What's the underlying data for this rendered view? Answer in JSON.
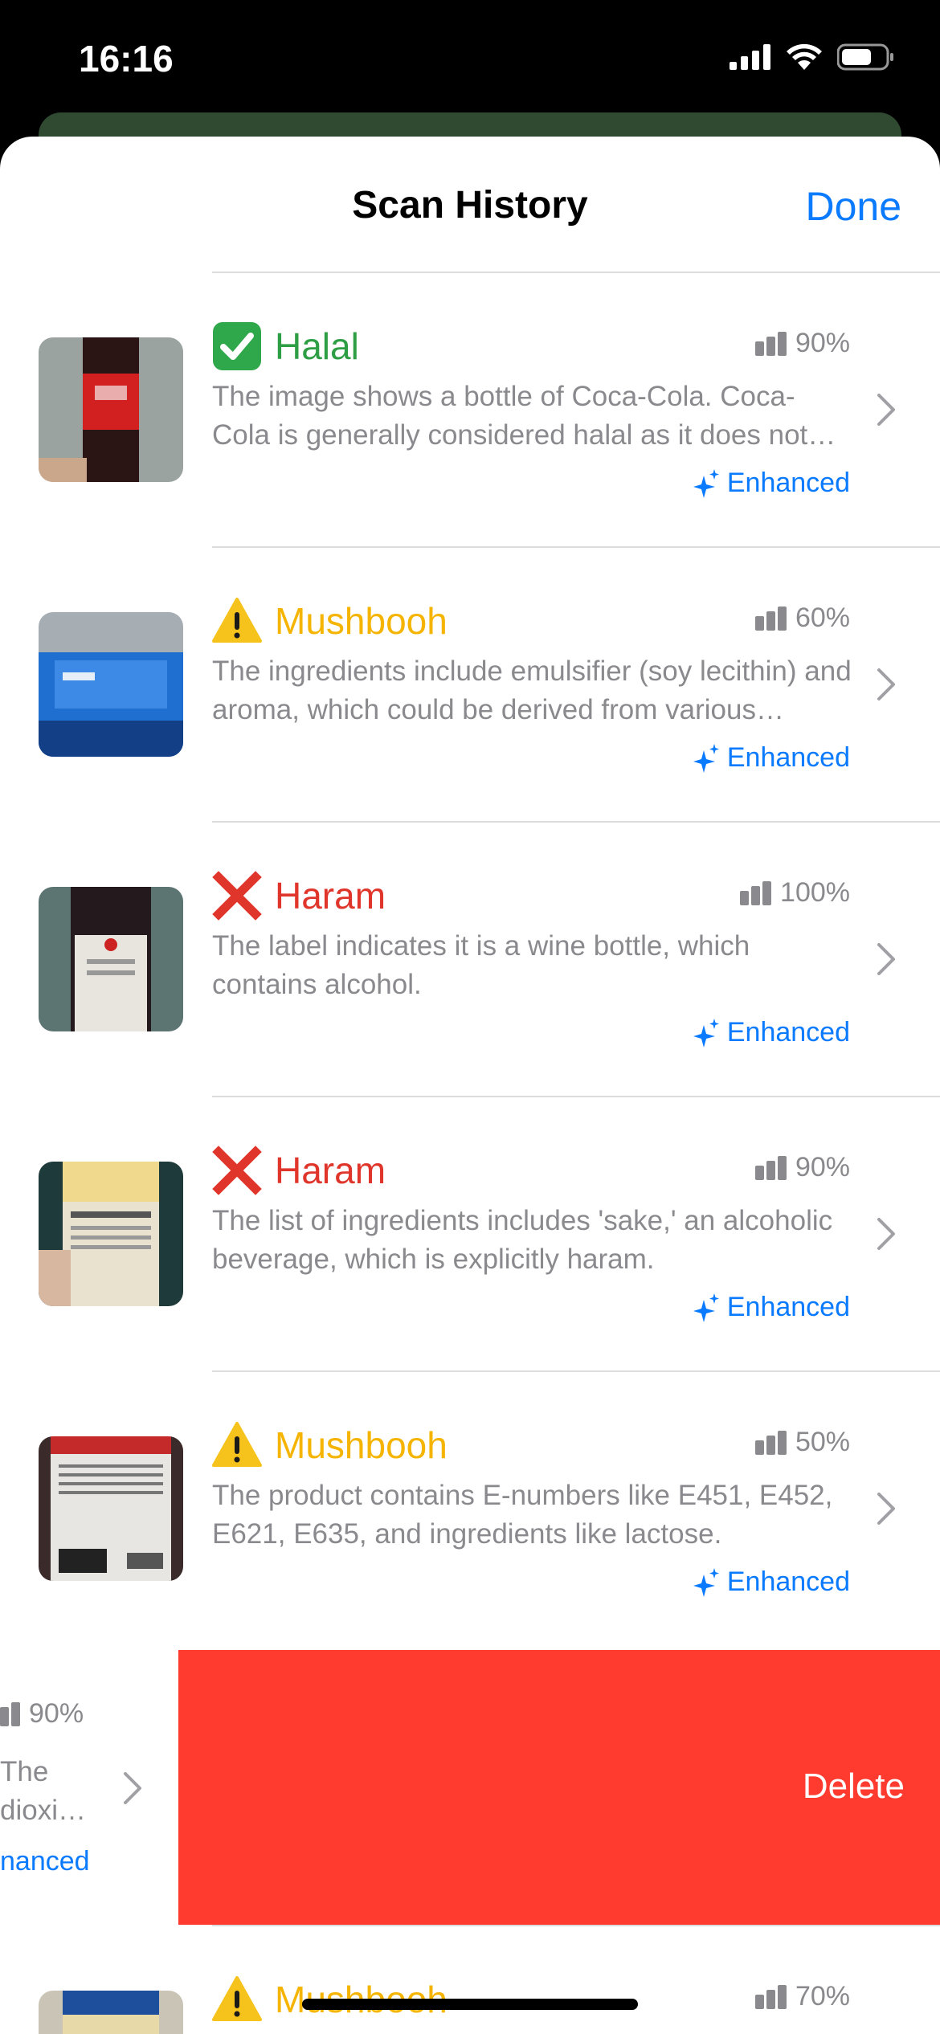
{
  "status_bar": {
    "time": "16:16"
  },
  "sheet": {
    "title": "Scan History",
    "done_label": "Done"
  },
  "items": [
    {
      "verdict": "Halal",
      "verdict_color": "#2e9e44",
      "confidence": "90%",
      "description": "The image shows a bottle of Coca-Cola. Coca-Cola is generally considered halal as it does not contain any haram ingredients.",
      "enhanced_label": "Enhanced",
      "icon": "check-icon"
    },
    {
      "verdict": "Mushbooh",
      "verdict_color": "#f5b400",
      "confidence": "60%",
      "description": "The ingredients include emulsifier (soy lecithin) and aroma, which could be derived from various sources.",
      "enhanced_label": "Enhanced",
      "icon": "warning-icon"
    },
    {
      "verdict": "Haram",
      "verdict_color": "#e0352b",
      "confidence": "100%",
      "description": "The label indicates it is a wine bottle, which contains alcohol.",
      "enhanced_label": "Enhanced",
      "icon": "cross-icon"
    },
    {
      "verdict": "Haram",
      "verdict_color": "#e0352b",
      "confidence": "90%",
      "description": "The list of ingredients includes 'sake,' an alcoholic beverage, which is explicitly haram.",
      "enhanced_label": "Enhanced",
      "icon": "cross-icon"
    },
    {
      "verdict": "Mushbooh",
      "verdict_color": "#f5b400",
      "confidence": "50%",
      "description": "The product contains E-numbers like E451, E452, E621, E635, and ingredients like lactose.",
      "enhanced_label": "Enhanced",
      "icon": "warning-icon"
    }
  ],
  "swiped_item": {
    "confidence": "90%",
    "line1": "The",
    "line2": "dioxi…",
    "enhanced_label": "nanced",
    "delete_label": "Delete"
  },
  "partial_item": {
    "verdict": "Mushbooh",
    "confidence": "70%"
  }
}
